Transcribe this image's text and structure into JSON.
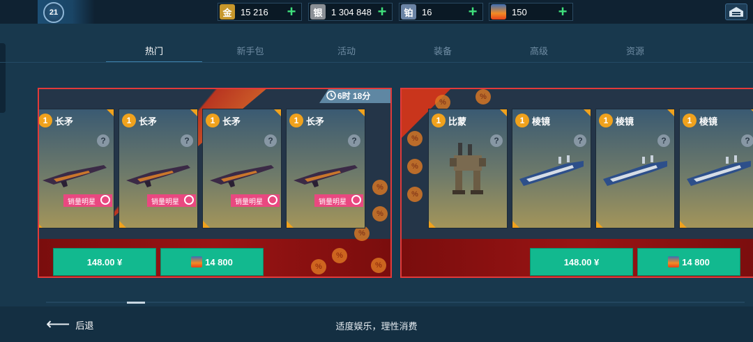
{
  "player": {
    "level": "21"
  },
  "resources": [
    {
      "name": "gold",
      "icon": "金",
      "value": "15 216",
      "color": "#c7972b"
    },
    {
      "name": "silver",
      "icon": "银",
      "value": "1 304 848",
      "color": "#8a8f95"
    },
    {
      "name": "platinum",
      "icon": "铂",
      "value": "16",
      "color": "#6b84a5"
    },
    {
      "name": "key",
      "icon": "key-icon",
      "value": "150",
      "color": "#e05a22"
    }
  ],
  "tabs": [
    "热门",
    "新手包",
    "活动",
    "装备",
    "高级",
    "资源"
  ],
  "active_tab": "热门",
  "offers": [
    {
      "timer": "6时 18分",
      "cards": [
        {
          "qty": "1",
          "name": "长矛",
          "tag": "销量明星"
        },
        {
          "qty": "1",
          "name": "长矛",
          "tag": "销量明星"
        },
        {
          "qty": "1",
          "name": "长矛",
          "tag": "销量明星"
        },
        {
          "qty": "1",
          "name": "长矛",
          "tag": "销量明星"
        }
      ],
      "price_money": "148.00 ¥",
      "price_keys": "14 800"
    },
    {
      "cards": [
        {
          "qty": "1",
          "name": "比蒙"
        },
        {
          "qty": "1",
          "name": "棱镜"
        },
        {
          "qty": "1",
          "name": "棱镜"
        },
        {
          "qty": "1",
          "name": "棱镜"
        }
      ],
      "price_money": "148.00 ¥",
      "price_keys": "14 800"
    }
  ],
  "footer": {
    "back_label": "后退",
    "note": "适度娱乐，理性消费"
  },
  "colors": {
    "accent_green": "#12b98f",
    "panel_red": "#e23a3a",
    "badge_orange": "#f0a21d",
    "tag_pink": "#e94880"
  }
}
